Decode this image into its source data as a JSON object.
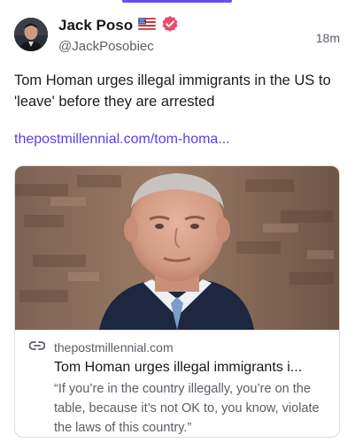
{
  "post": {
    "author": {
      "display_name": "Jack Poso",
      "flag_icon": "us-flag-icon",
      "verified_icon": "verified-badge-icon",
      "verified_color": "#ec4a6f",
      "handle": "@JackPosobiec"
    },
    "timestamp": "18m",
    "text": "Tom Homan urges illegal immigrants in the US to 'leave' before they are arrested",
    "link_text": "thepostmillennial.com/tom-homa..."
  },
  "link_card": {
    "link_icon": "link-icon",
    "domain": "thepostmillennial.com",
    "title": "Tom Homan urges illegal immigrants i...",
    "description": "“If you’re in the country illegally, you’re on the table, because it’s not OK to, you know, violate the laws of this country.”"
  },
  "colors": {
    "accent": "#6c4cf1",
    "link": "#5b3fe0",
    "text": "#1b1b1f",
    "muted": "#5c5c66"
  }
}
